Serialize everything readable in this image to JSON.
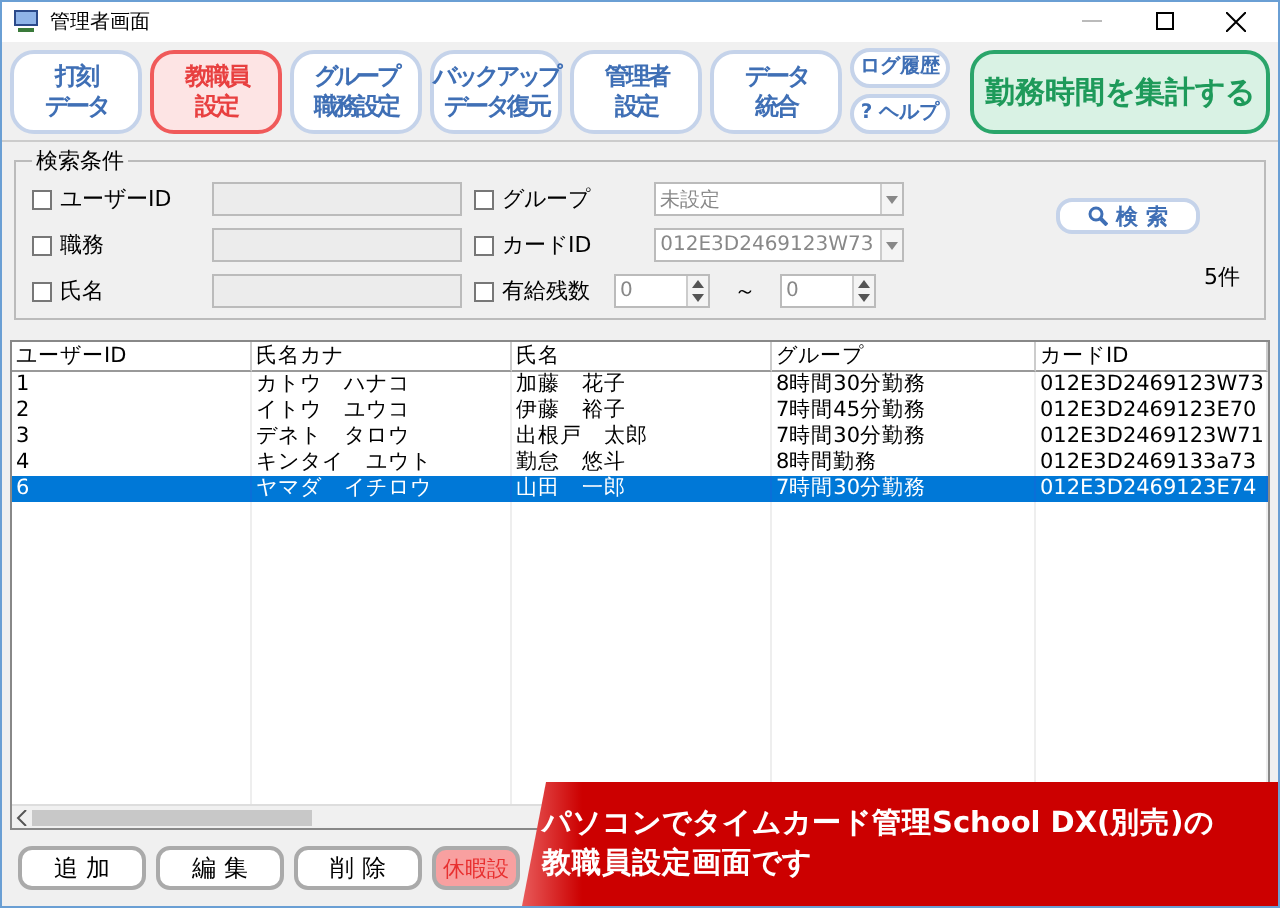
{
  "window": {
    "title": "管理者画面"
  },
  "toolbar": [
    {
      "kind": "main",
      "lines": [
        "打刻",
        "データ"
      ],
      "selected": false
    },
    {
      "kind": "main",
      "lines": [
        "教職員",
        "設定"
      ],
      "selected": true
    },
    {
      "kind": "main",
      "lines": [
        "グループ",
        "職務設定"
      ],
      "selected": false
    },
    {
      "kind": "main",
      "lines": [
        "バックアップ",
        "データ復元"
      ],
      "selected": false
    },
    {
      "kind": "main",
      "lines": [
        "管理者",
        "設定"
      ],
      "selected": false
    },
    {
      "kind": "main",
      "lines": [
        "データ",
        "統合"
      ],
      "selected": false
    },
    {
      "kind": "small",
      "lines": [
        "ログ履歴"
      ],
      "selected": false
    },
    {
      "kind": "small",
      "lines": [
        "? ヘルプ"
      ],
      "selected": false
    },
    {
      "kind": "primary",
      "lines": [
        "勤務時間を集計する"
      ],
      "selected": false
    }
  ],
  "search": {
    "title": "検索条件",
    "left": [
      {
        "label": "ユーザーID",
        "checked": false
      },
      {
        "label": "職務",
        "checked": false
      },
      {
        "label": "氏名",
        "checked": false
      }
    ],
    "group": {
      "label": "グループ",
      "checked": false,
      "value": "未設定"
    },
    "card": {
      "label": "カードID",
      "checked": false,
      "value": "012E3D2469123W73"
    },
    "leave": {
      "label": "有給残数",
      "checked": false,
      "from": "0",
      "to": "0",
      "tilde": "～"
    },
    "button": "検 索",
    "count": "5件"
  },
  "table": {
    "columns": [
      "ユーザーID",
      "氏名カナ",
      "氏名",
      "グループ",
      "カードID"
    ],
    "rows": [
      {
        "cells": [
          "1",
          "カトウ　ハナコ",
          "加藤　花子",
          "8時間30分勤務",
          "012E3D2469123W73"
        ],
        "selected": false
      },
      {
        "cells": [
          "2",
          "イトウ　ユウコ",
          "伊藤　裕子",
          "7時間45分勤務",
          "012E3D2469123E70"
        ],
        "selected": false
      },
      {
        "cells": [
          "3",
          "デネト　タロウ",
          "出根戸　太郎",
          "7時間30分勤務",
          "012E3D2469123W71"
        ],
        "selected": false
      },
      {
        "cells": [
          "4",
          "キンタイ　ユウト",
          "勤怠　悠斗",
          "8時間勤務",
          "012E3D2469133a73"
        ],
        "selected": false
      },
      {
        "cells": [
          "6",
          "ヤマダ　イチロウ",
          "山田　一郎",
          "7時間30分勤務",
          "012E3D2469123E74"
        ],
        "selected": true
      }
    ]
  },
  "bottom_buttons": [
    {
      "label": "追 加",
      "kind": "plain"
    },
    {
      "label": "編 集",
      "kind": "plain"
    },
    {
      "label": "削 除",
      "kind": "plain"
    },
    {
      "label": "休暇設",
      "kind": "accent"
    }
  ],
  "banner": {
    "lines": [
      "パソコンでタイムカード管理School DX(別売)の",
      "教職員設定画面です"
    ]
  }
}
